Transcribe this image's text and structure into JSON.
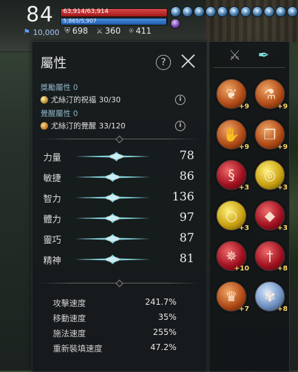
{
  "hud": {
    "level": "84",
    "hp_text": "63,914/63,914",
    "hp_fraction": 1.0,
    "mp_text": "5,865/5,907",
    "mp_fraction": 0.993,
    "xp_value": "10,000",
    "stat_defense": "698",
    "stat_resist": "360",
    "stat_other": "411",
    "buff_count": 12
  },
  "panel": {
    "title": "屬性",
    "reward_label": "獎勵屬性 0",
    "reward_item": "尤絲汀的祝福",
    "reward_value": "30/30",
    "awaken_label": "覺醒屬性 0",
    "awaken_item": "尤絲汀的覺醒",
    "awaken_value": "33/120",
    "attributes": [
      {
        "name": "力量",
        "value": "78",
        "level": 0.55
      },
      {
        "name": "敏捷",
        "value": "86",
        "level": 0.5
      },
      {
        "name": "智力",
        "value": "136",
        "level": 0.5
      },
      {
        "name": "體力",
        "value": "97",
        "level": 0.5
      },
      {
        "name": "靈巧",
        "value": "87",
        "level": 0.5
      },
      {
        "name": "精神",
        "value": "81",
        "level": 0.5
      }
    ],
    "speeds": [
      {
        "label": "攻擊速度",
        "value": "241.7%"
      },
      {
        "label": "移動速度",
        "value": "35%"
      },
      {
        "label": "施法速度",
        "value": "255%"
      },
      {
        "label": "重新裝填速度",
        "value": "47.2%"
      }
    ]
  },
  "equipment": {
    "slots": [
      {
        "icon": "amulet-icon",
        "plus": "+9",
        "color": "orange"
      },
      {
        "icon": "potion-icon",
        "plus": "+9",
        "color": "orange"
      },
      {
        "icon": "gauntlet-icon",
        "plus": "+9",
        "color": "orange"
      },
      {
        "icon": "chest-icon",
        "plus": "+9",
        "color": "orange"
      },
      {
        "icon": "serpent-icon",
        "plus": "+3",
        "color": "red"
      },
      {
        "icon": "ring-gold-icon",
        "plus": "+3",
        "color": "yellow"
      },
      {
        "icon": "ring-icon",
        "plus": "+3",
        "color": "yellow"
      },
      {
        "icon": "crystal-icon",
        "plus": "+3",
        "color": "red"
      },
      {
        "icon": "compass-icon",
        "plus": "+10",
        "color": "red"
      },
      {
        "icon": "sword-icon",
        "plus": "+8",
        "color": "red"
      },
      {
        "icon": "crown-icon",
        "plus": "+7",
        "color": "orange"
      },
      {
        "icon": "flower-icon",
        "plus": "+8",
        "color": "blue"
      }
    ]
  }
}
